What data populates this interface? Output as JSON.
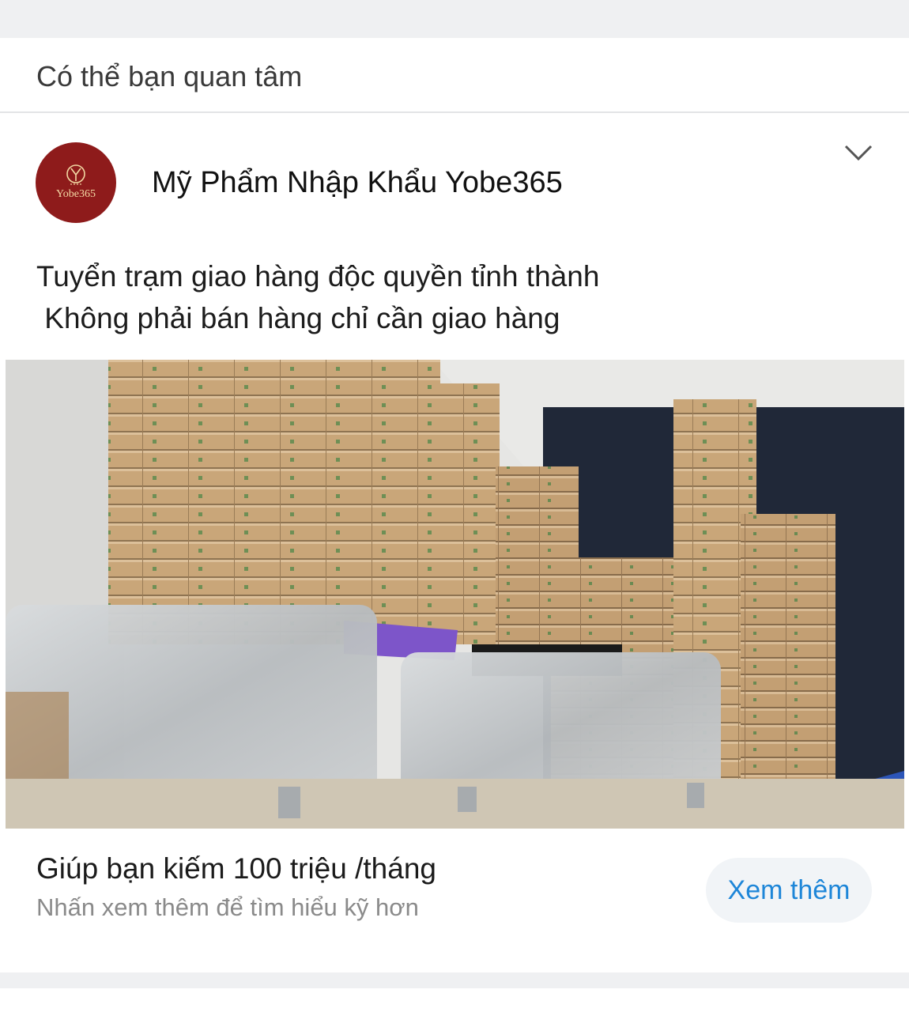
{
  "section": {
    "title": "Có thể bạn quan tâm"
  },
  "post": {
    "avatar_text": "Yobe365",
    "page_name": "Mỹ Phẩm Nhập Khẩu Yobe365",
    "caption": "Tuyển trạm giao hàng độc quyền tỉnh thành\n Không phải bán hàng chỉ cần giao hàng",
    "image_subject": "stacked-cardboard-boxes-office-photo",
    "headline": "Giúp bạn kiếm 100 triệu /tháng",
    "subtext": "Nhấn xem thêm để tìm hiểu kỹ hơn",
    "cta_label": "Xem thêm"
  },
  "colors": {
    "brand_red": "#8e1b1b",
    "link_blue": "#1e86d8",
    "band_gray": "#eff0f2"
  },
  "icons": {
    "options": "chevron-down-icon"
  }
}
